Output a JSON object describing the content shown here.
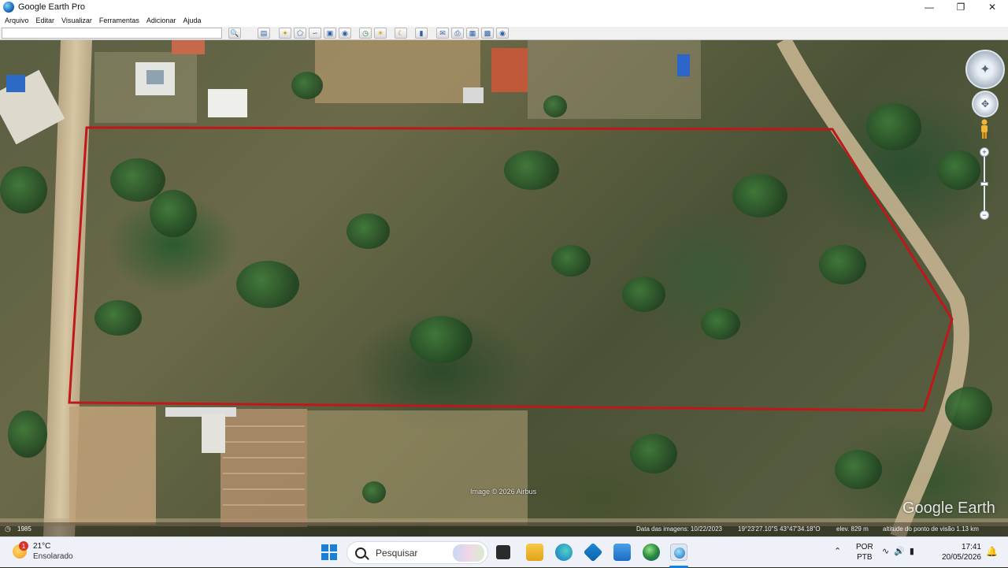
{
  "window": {
    "title": "Google Earth Pro",
    "minimize_icon": "minimize-icon",
    "maximize_icon": "maximize-icon",
    "close_icon": "close-icon"
  },
  "menu": {
    "items": [
      "Arquivo",
      "Editar",
      "Visualizar",
      "Ferramentas",
      "Adicionar",
      "Ajuda"
    ]
  },
  "toolbar": {
    "search_value": "",
    "icons": [
      "search-icon",
      "sidebar-toggle-icon",
      "placemark-icon",
      "polygon-icon",
      "path-icon",
      "image-overlay-icon",
      "record-tour-icon",
      "historical-imagery-icon",
      "sun-icon",
      "planets-icon",
      "ruler-icon",
      "email-icon",
      "print-icon",
      "save-image-icon",
      "view-in-maps-icon",
      "earth-icon"
    ]
  },
  "map": {
    "attribution": "Image © 2026 Airbus",
    "logo": "Google Earth",
    "year": "1985",
    "image_date": "Data das imagens: 10/22/2023",
    "coordinates": "19°23'27.10\"S   43°47'34.18\"O",
    "elevation": "elev.  829 m",
    "eye_altitude": "altitude do ponto de visão   1.13 km",
    "boundary_color": "#c0181a"
  },
  "taskbar": {
    "weather_temp": "21°C",
    "weather_desc": "Ensolarado",
    "weather_badge": "1",
    "search_label": "Pesquisar",
    "lang_top": "POR",
    "lang_bottom": "PTB",
    "time": "17:41",
    "date": "20/05/2026",
    "apps": [
      "file-explorer-icon",
      "folder-icon",
      "edge-icon",
      "store-icon",
      "mail-icon",
      "google-earth-icon",
      "google-earth-pro-icon"
    ]
  }
}
